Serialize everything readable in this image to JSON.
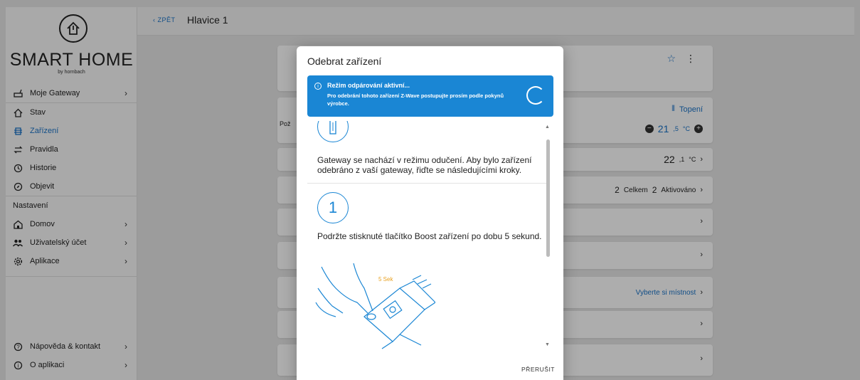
{
  "sidebar": {
    "brand": "SMART HOME",
    "brand_sub": "by hornbach",
    "items": [
      {
        "label": "Moje Gateway",
        "icon": "gateway-icon",
        "chevron": "›"
      },
      {
        "label": "Stav",
        "icon": "home-icon"
      },
      {
        "label": "Zařízení",
        "icon": "device-icon",
        "active": true
      },
      {
        "label": "Pravidla",
        "icon": "rules-icon"
      },
      {
        "label": "Historie",
        "icon": "history-icon"
      },
      {
        "label": "Objevit",
        "icon": "compass-icon"
      }
    ],
    "settings_label": "Nastavení",
    "settings_items": [
      {
        "label": "Domov",
        "icon": "house-icon",
        "chevron": "›"
      },
      {
        "label": "Uživatelský účet",
        "icon": "users-icon",
        "chevron": "›"
      },
      {
        "label": "Aplikace",
        "icon": "gear-icon",
        "chevron": "›"
      }
    ],
    "bottom_items": [
      {
        "label": "Nápověda & kontakt",
        "icon": "help-icon",
        "chevron": "›"
      },
      {
        "label": "O aplikaci",
        "icon": "info-icon",
        "chevron": "›"
      }
    ]
  },
  "topbar": {
    "back_label": "‹ ZPĚT",
    "title": "Hlavice 1"
  },
  "background": {
    "heating_label": "Topení",
    "temp_set_main": "21",
    "temp_set_dec": ",5",
    "temp_set_unit": "°C",
    "temp_now_main": "22",
    "temp_now_dec": ",1",
    "temp_now_unit": "°C",
    "total_count": "2",
    "total_label": "Celkem",
    "active_count": "2",
    "active_label": "Aktivováno",
    "room_select": "Vyberte si místnost",
    "row_prefix": "Pož"
  },
  "modal": {
    "title": "Odebrat zařízení",
    "alert_title": "Režim odpárování aktivní...",
    "alert_text": "Pro odebrání tohoto zařízení Z-Wave postupujte prosím podle pokynů výrobce.",
    "intro_text": "Gateway se nachází v režimu odučení. Aby bylo zařízení odebráno z vaší gateway, řiďte se následujícími kroky.",
    "step_number": "1",
    "step_text": "Podržte stisknuté tlačítko Boost zařízení po dobu 5 sekund.",
    "illustration_label": "5 Sek",
    "abort_label": "PŘERUŠIT"
  },
  "colors": {
    "accent": "#1a73c8",
    "alert_bg": "#1a86d4",
    "illustration_label": "#e8a020"
  }
}
